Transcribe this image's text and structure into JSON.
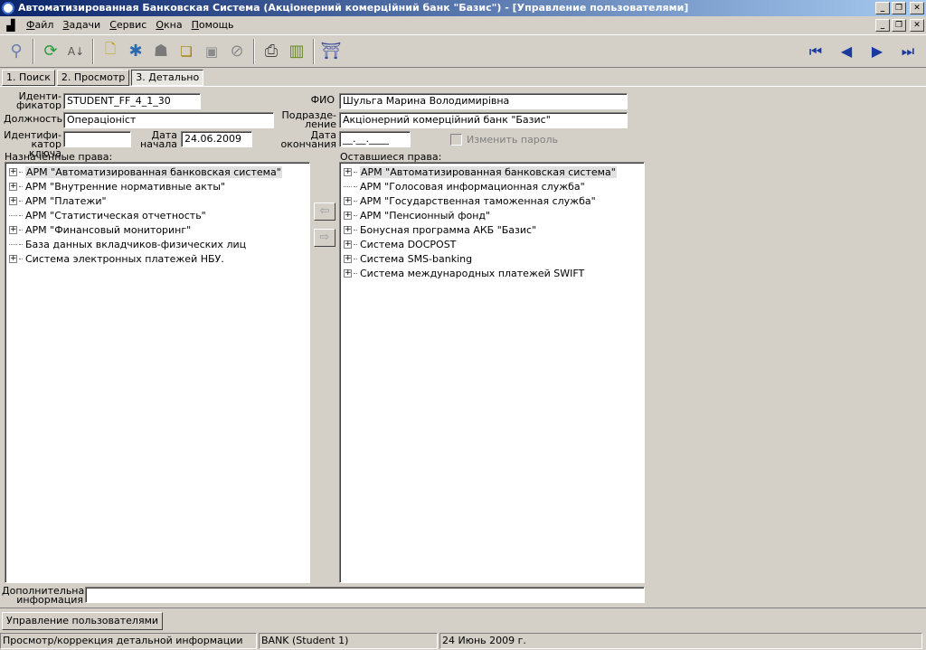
{
  "window": {
    "title": "Автоматизированная Банковская Система (Акціонерний комерційний банк \"Базис\") - [Управление пользователями]"
  },
  "menu": {
    "items": [
      "Файл",
      "Задачи",
      "Сервис",
      "Окна",
      "Помощь"
    ]
  },
  "toolbar": {
    "icons": [
      "magnifier-icon",
      "refresh-icon",
      "sort-icon",
      "new-document-icon",
      "tools-icon",
      "user-icon",
      "copy-icon",
      "save-icon",
      "cancel-icon",
      "print-icon",
      "chart-icon",
      "door-exit-icon"
    ],
    "nav": [
      "first-record-icon",
      "previous-record-icon",
      "next-record-icon",
      "last-record-icon"
    ]
  },
  "tabs": [
    "1. Поиск",
    "2. Просмотр",
    "3. Детально"
  ],
  "form": {
    "identifier_label_1": "Иденти-",
    "identifier_label_2": "фикатор",
    "identifier_value": "STUDENT_FF_4_1_30",
    "fio_label": "ФИО",
    "fio_value": "Шульга Марина Володимирівна",
    "position_label": "Должность",
    "position_value": "Операціоніст",
    "department_label_1": "Подразде-",
    "department_label_2": "ление",
    "department_value": "Акціонерний комерційний банк \"Базис\"",
    "key_id_label_1": "Идентифи-",
    "key_id_label_2": "катор ключа",
    "key_id_value": "",
    "start_date_label_1": "Дата",
    "start_date_label_2": "начала",
    "start_date_value": "24.06.2009",
    "end_date_label_1": "Дата",
    "end_date_label_2": "окончания",
    "end_date_value": "__.__.____",
    "change_password_label": "Изменить пароль",
    "assigned_rights_label": "Назначенные права:",
    "remaining_rights_label": "Оставшиеся права:",
    "additional_info_label_1": "Дополнительная",
    "additional_info_label_2": "информация",
    "additional_info_value": ""
  },
  "assigned_rights": [
    {
      "label": "АРМ \"Автоматизированная банковская система\"",
      "expandable": true,
      "selected": true
    },
    {
      "label": "АРМ \"Внутренние нормативные акты\"",
      "expandable": true
    },
    {
      "label": "АРМ \"Платежи\"",
      "expandable": true
    },
    {
      "label": "АРМ \"Статистическая отчетность\"",
      "expandable": false
    },
    {
      "label": "АРМ \"Финансовый мониторинг\"",
      "expandable": true
    },
    {
      "label": "База данных вкладчиков-физических лиц",
      "expandable": false
    },
    {
      "label": "Система электронных платежей НБУ.",
      "expandable": true
    }
  ],
  "remaining_rights": [
    {
      "label": "АРМ \"Автоматизированная банковская система\"",
      "expandable": true,
      "selected": true
    },
    {
      "label": "АРМ \"Голосовая информационная служба\"",
      "expandable": false
    },
    {
      "label": "АРМ \"Государственная таможенная служба\"",
      "expandable": true
    },
    {
      "label": "АРМ \"Пенсионный фонд\"",
      "expandable": true
    },
    {
      "label": "Бонусная программа АКБ \"Базис\"",
      "expandable": true
    },
    {
      "label": "Система DOCPOST",
      "expandable": true
    },
    {
      "label": "Система SMS-banking",
      "expandable": true
    },
    {
      "label": "Система международных платежей SWIFT",
      "expandable": true
    }
  ],
  "taskbar": {
    "task": "Управление пользователями"
  },
  "status": {
    "mode": "Просмотр/коррекция детальной информации",
    "user": "BANK (Student 1)",
    "date": "24 Июнь 2009 г."
  }
}
